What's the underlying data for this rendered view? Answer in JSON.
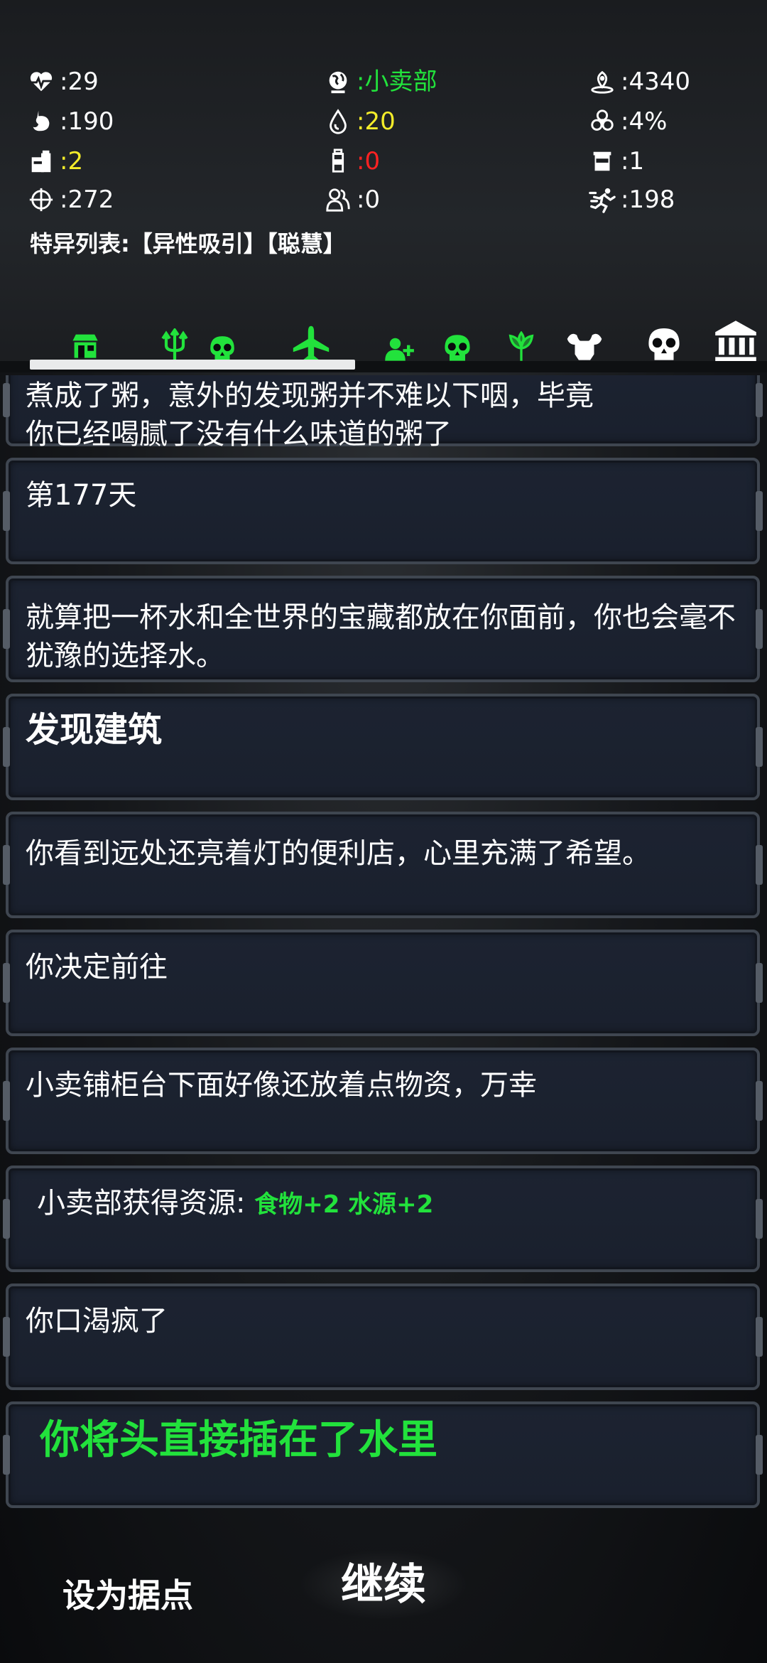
{
  "stats": {
    "health": ":29",
    "location": ":小卖部",
    "distance": ":4340",
    "food": ":190",
    "water": ":20",
    "infection": ":4%",
    "food_items": ":2",
    "bottles": ":0",
    "cans": ":1",
    "crosshair": ":272",
    "people": ":0",
    "speed": ":198",
    "traits": "特异列表:【异性吸引】【聪慧】",
    "colors": {
      "green": "#22e23c",
      "yellow": "#f4ec2a",
      "red": "#ff2222"
    }
  },
  "nav": {
    "progress": 0.46,
    "icons": [
      "store-icon",
      "trident-icon",
      "skull-icon",
      "airplane-icon",
      "add-person-icon",
      "skull-icon",
      "plant-icon",
      "muscle-icon",
      "skull-icon",
      "bank-icon"
    ]
  },
  "log": {
    "entry0_line1": "煮成了粥，意外的发现粥并不难以下咽，毕竟",
    "entry0_line2": "你已经喝腻了没有什么味道的粥了",
    "entry1": "第177天",
    "entry2": "就算把一杯水和全世界的宝藏都放在你面前，你也会毫不犹豫的选择水。",
    "entry3": "发现建筑",
    "entry4": "你看到远处还亮着灯的便利店，心里充满了希望。",
    "entry5": "你决定前往",
    "entry6": "小卖铺柜台下面好像还放着点物资，万幸",
    "entry7_prefix": "小卖部获得资源:",
    "entry7_res": "食物+2 水源+2",
    "entry8": "你口渴疯了",
    "entry9": "你将头直接插在了水里"
  },
  "buttons": {
    "set_base": "设为据点",
    "continue": "继续"
  }
}
